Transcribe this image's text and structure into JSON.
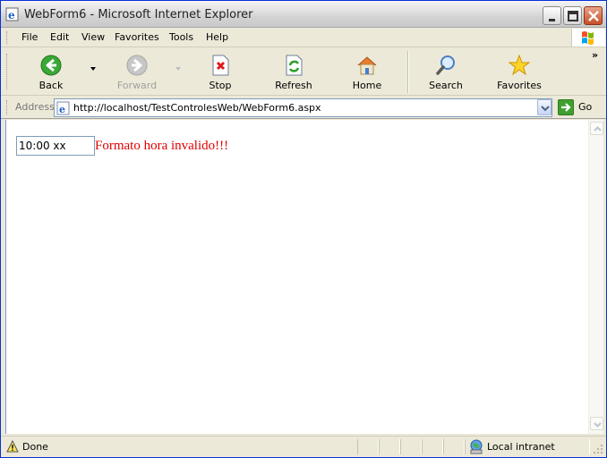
{
  "window": {
    "title": "WebForm6 - Microsoft Internet Explorer"
  },
  "menu": {
    "items": [
      {
        "label": "File"
      },
      {
        "label": "Edit"
      },
      {
        "label": "View"
      },
      {
        "label": "Favorites"
      },
      {
        "label": "Tools"
      },
      {
        "label": "Help"
      }
    ]
  },
  "toolbar": {
    "back_label": "Back",
    "forward_label": "Forward",
    "stop_label": "Stop",
    "refresh_label": "Refresh",
    "home_label": "Home",
    "search_label": "Search",
    "favorites_label": "Favorites",
    "more_glyph": "»"
  },
  "address": {
    "label": "Address",
    "url": "http://localhost/TestControlesWeb/WebForm6.aspx",
    "go_label": "Go"
  },
  "page": {
    "time_input_value": "10:00 xx",
    "error_message": "Formato hora invalido!!!",
    "error_color": "#e00000"
  },
  "status": {
    "text": "Done",
    "zone": "Local intranet"
  }
}
